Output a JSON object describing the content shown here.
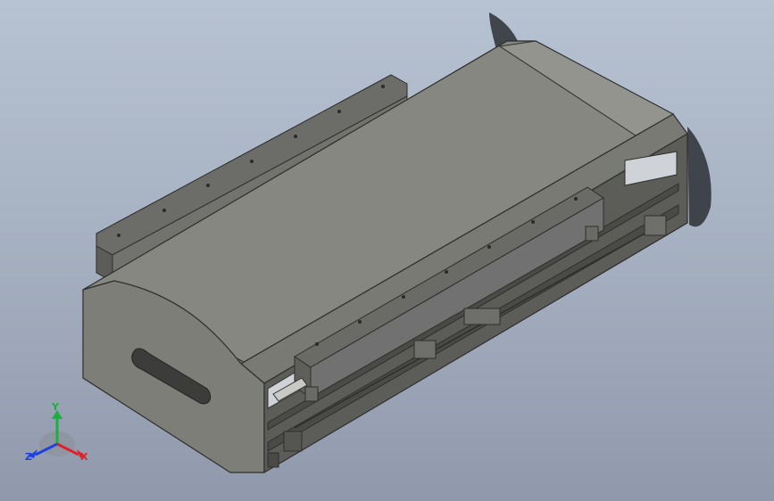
{
  "viewport": {
    "colors": {
      "background_top": "#b7c2d2",
      "background_bottom": "#9099ab",
      "body_face": "#7f807a",
      "body_top": "#8a8b84",
      "edge": "#3a3a38"
    }
  },
  "triad": {
    "x_label": "X",
    "y_label": "Y",
    "z_label": "Z",
    "x_color": "#e0202a",
    "y_color": "#18b040",
    "z_color": "#2040e0"
  }
}
